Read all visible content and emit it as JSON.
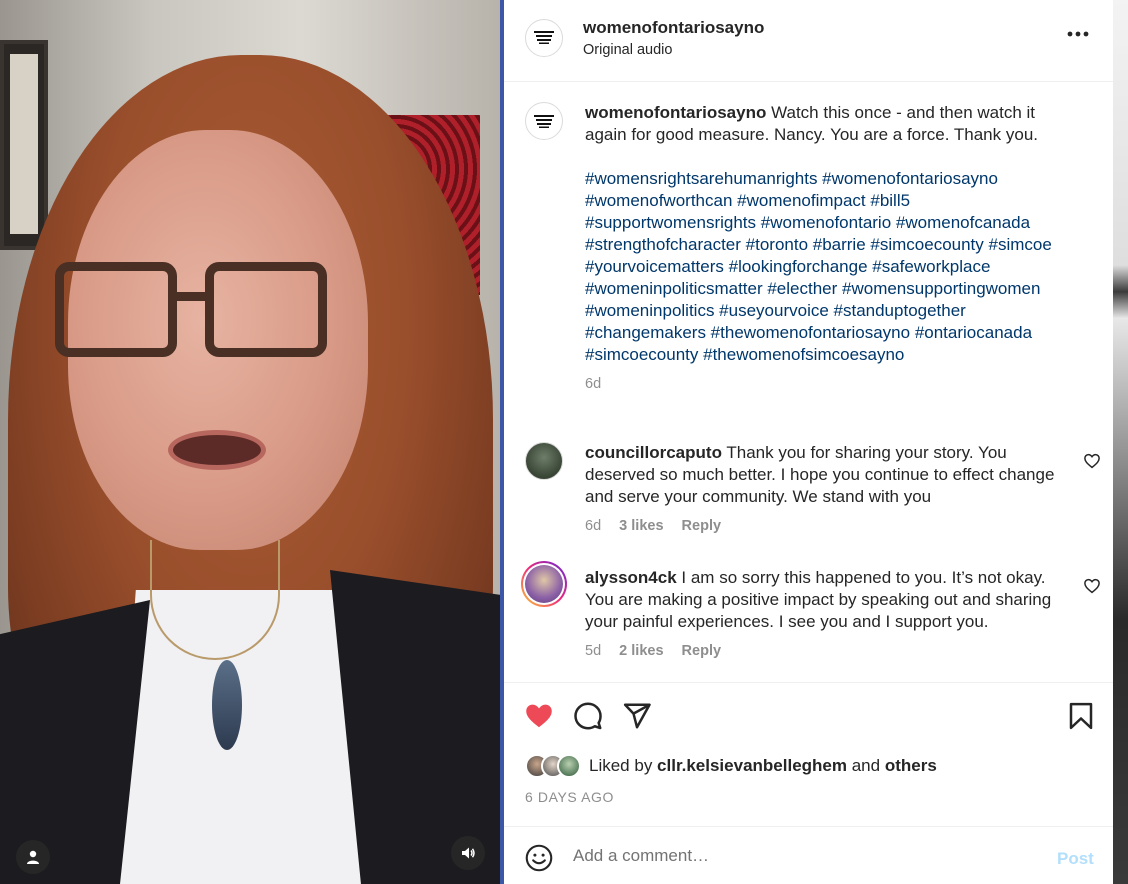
{
  "post": {
    "username": "womenofontariosayno",
    "audio": "Original audio",
    "avatar_logo": "The Women of Ontario Say No",
    "more": "•••"
  },
  "caption": {
    "username": "womenofontariosayno",
    "text": " Watch this once - and then watch it again for good measure. Nancy. You are a force. Thank you.",
    "hashtags": "#womensrightsarehumanrights #womenofontariosayno #womenofworthcan #womenofimpact #bill5 #supportwomensrights #womenofontario #womenofcanada #strengthofcharacter #toronto #barrie #simcoecounty #simcoe #yourvoicematters #lookingforchange #safeworkplace #womeninpoliticsmatter #electher #womensupportingwomen #womeninpolitics #useyourvoice #standuptogether #changemakers #thewomenofontariosayno #ontariocanada #simcoecounty #thewomenofsimcoesayno",
    "time": "6d"
  },
  "comments": [
    {
      "username": "councillorcaputo",
      "text": " Thank you for sharing your story. You deserved so much better. I hope you continue to effect change and serve your community. We stand with you",
      "time": "6d",
      "likes": "3 likes",
      "reply": "Reply"
    },
    {
      "username": "alysson4ck",
      "text": " I am so sorry this happened to you. It’s not okay. You are making a positive impact by speaking out and sharing your painful experiences. I see you and I support you.",
      "time": "5d",
      "likes": "2 likes",
      "reply": "Reply"
    }
  ],
  "likes": {
    "prefix": "Liked by ",
    "user": "cllr.kelsievanbelleghem",
    "middle": " and ",
    "others": "others"
  },
  "date": "6 DAYS AGO",
  "add_comment": {
    "placeholder": "Add a comment…",
    "post_label": "Post"
  },
  "colors": {
    "like_red": "#ed4956",
    "hashtag_blue": "#00376b",
    "post_disabled": "#b2dffc"
  },
  "icons": [
    "user-icon",
    "volume-icon",
    "more-icon",
    "heart-icon",
    "comment-icon",
    "share-icon",
    "bookmark-icon",
    "emoji-icon"
  ]
}
